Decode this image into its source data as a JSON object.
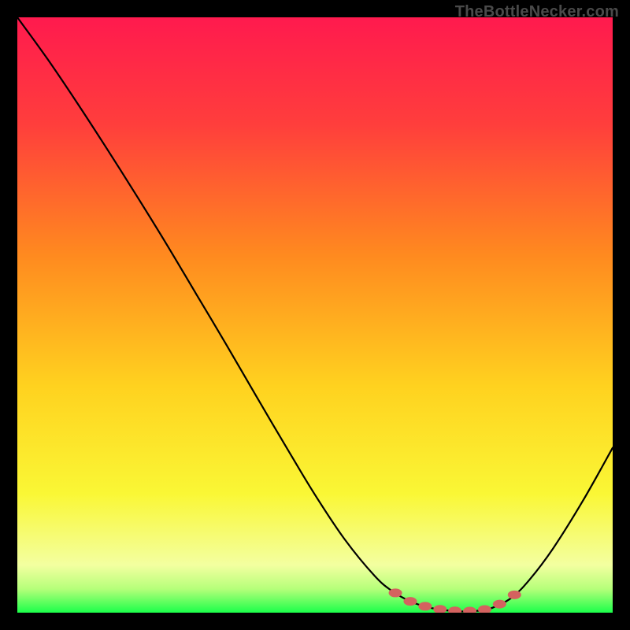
{
  "watermark": "TheBottleNecker.com",
  "chart_data": {
    "type": "line",
    "title": "",
    "xlabel": "",
    "ylabel": "",
    "xlim": [
      0,
      100
    ],
    "ylim": [
      0,
      100
    ],
    "x": [
      0,
      5,
      10,
      15,
      20,
      25,
      30,
      35,
      40,
      45,
      50,
      55,
      60,
      63,
      66,
      69,
      72,
      75,
      78,
      80,
      83,
      86,
      90,
      95,
      100
    ],
    "values": [
      100,
      93.1,
      85.7,
      78.0,
      70.1,
      62.0,
      53.6,
      45.2,
      36.6,
      28.1,
      19.8,
      12.3,
      6.2,
      3.6,
      1.9,
      0.9,
      0.4,
      0.2,
      0.4,
      0.9,
      2.5,
      5.5,
      10.8,
      18.8,
      27.7
    ],
    "marker_points_x": [
      63.5,
      66,
      68.5,
      71,
      73.5,
      76,
      78.5,
      81,
      83.5
    ],
    "gradient": {
      "stops": [
        {
          "offset": 0,
          "color": "#ff1a4e"
        },
        {
          "offset": 18,
          "color": "#ff3e3c"
        },
        {
          "offset": 40,
          "color": "#ff8a1f"
        },
        {
          "offset": 62,
          "color": "#ffd21f"
        },
        {
          "offset": 80,
          "color": "#faf735"
        },
        {
          "offset": 92,
          "color": "#f3ffa0"
        },
        {
          "offset": 96,
          "color": "#b6ff7a"
        },
        {
          "offset": 100,
          "color": "#1bff4a"
        }
      ]
    },
    "curve_color": "#000000",
    "marker_color": "#d4625f"
  }
}
